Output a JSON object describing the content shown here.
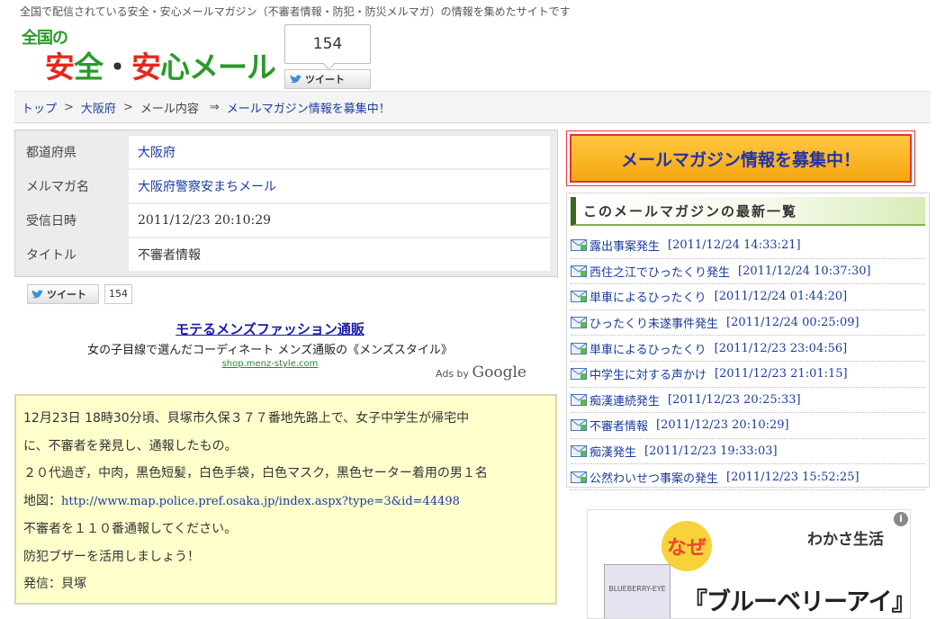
{
  "header": {
    "tagline": "全国で配信されている安全・安心メールマガジン（不審者情報・防犯・防災メルマガ）の情報を集めたサイトです",
    "logo_line1": "全国の",
    "logo_line2": "安全・安心メール",
    "tweet_count": "154",
    "tweet_label": "ツイート"
  },
  "breadcrumb": {
    "items": [
      "トップ",
      "大阪府",
      "メール内容"
    ],
    "separator": ">",
    "arrow": "⇒",
    "recruit_link": "メールマガジン情報を募集中！"
  },
  "info": {
    "rows": [
      {
        "label": "都道府県",
        "value": "大阪府"
      },
      {
        "label": "メルマガ名",
        "value": "大阪府警察安まちメール"
      },
      {
        "label": "受信日時",
        "value": "2011/12/23 20:10:29"
      },
      {
        "label": "タイトル",
        "value": "不審者情報"
      }
    ]
  },
  "tweet_small": {
    "label": "ツイート",
    "count": "154"
  },
  "ad": {
    "title": "モテるメンズファッション通販",
    "desc": "女の子目線で選んだコーディネート メンズ通販の《メンズスタイル》",
    "url": "shop.menz-style.com",
    "ads_by": "Ads by",
    "google": "Google"
  },
  "message": {
    "lines": [
      "12月23日 18時30分頃、貝塚市久保３７７番地先路上で、女子中学生が帰宅中",
      "に、不審者を発見し、通報したもの。",
      "２０代過ぎ，中肉，黒色短髪，白色手袋，白色マスク，黒色セーター着用の男１名"
    ],
    "map_label": "地図：",
    "map_url": "http://www.map.police.pref.osaka.jp/index.aspx?type=3&id=44498",
    "line_call": "不審者を１１０番通報してください。",
    "line_buzzer": "防犯ブザーを活用しましょう！",
    "line_sender": "発信：貝塚"
  },
  "sidebar": {
    "recruit_button": "メールマガジン情報を募集中！",
    "latest_title": "このメールマガジンの最新一覧",
    "latest": [
      {
        "title": "露出事案発生",
        "date": "[2011/12/24 14:33:21]"
      },
      {
        "title": "西住之江でひったくり発生",
        "date": "[2011/12/24 10:37:30]"
      },
      {
        "title": "単車によるひったくり",
        "date": "[2011/12/24 01:44:20]"
      },
      {
        "title": "ひったくり未遂事件発生",
        "date": "[2011/12/24 00:25:09]"
      },
      {
        "title": "単車によるひったくり",
        "date": "[2011/12/23 23:04:56]"
      },
      {
        "title": "中学生に対する声かけ",
        "date": "[2011/12/23 21:01:15]"
      },
      {
        "title": "痴漢連続発生",
        "date": "[2011/12/23 20:25:33]"
      },
      {
        "title": "不審者情報",
        "date": "[2011/12/23 20:10:29]"
      },
      {
        "title": "痴漢発生",
        "date": "[2011/12/23 19:33:03]"
      },
      {
        "title": "公然わいせつ事案の発生",
        "date": "[2011/12/23 15:52:25]"
      }
    ]
  },
  "banner": {
    "naze": "なぜ",
    "brand": "わかさ生活",
    "pack": "BLUEBERRY-EYE",
    "headline": "『ブルーベリーアイ』は"
  },
  "colors": {
    "link": "#1a3c9e",
    "message_bg": "#ffffcc",
    "recruit_bg": "#f6a60f",
    "recruit_text": "#2233aa",
    "logo_red": "#e8261b",
    "logo_green": "#2a9a2a"
  }
}
